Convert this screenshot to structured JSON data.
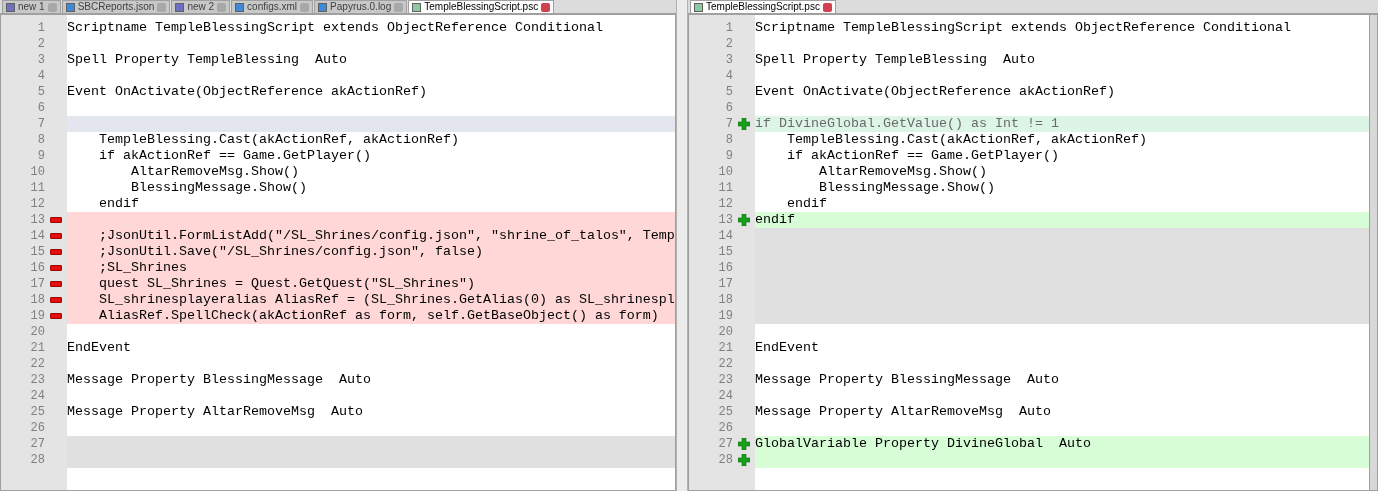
{
  "left_pane": {
    "tabs": [
      {
        "label": "new 1",
        "selected": false,
        "color": "#7070c0"
      },
      {
        "label": "SBCReports.json",
        "selected": false,
        "color": "#3c8ad8"
      },
      {
        "label": "new 2",
        "selected": false,
        "color": "#7070c0"
      },
      {
        "label": "configs.xml",
        "selected": false,
        "color": "#3c8ad8"
      },
      {
        "label": "Papyrus.0.log",
        "selected": false,
        "color": "#3c8ad8"
      },
      {
        "label": "TempleBlessingScript.psc",
        "selected": true,
        "color": "#8cc8a0"
      }
    ],
    "lines": [
      {
        "n": "1",
        "kind": "normal",
        "text": "Scriptname TempleBlessingScript extends ObjectReference Conditional"
      },
      {
        "n": "2",
        "kind": "normal"
      },
      {
        "n": "3",
        "kind": "normal",
        "text": "Spell Property TempleBlessing  Auto"
      },
      {
        "n": "4",
        "kind": "normal"
      },
      {
        "n": "5",
        "kind": "normal",
        "text": "Event OnActivate(ObjectReference akActionRef)"
      },
      {
        "n": "6",
        "kind": "normal"
      },
      {
        "n": "7",
        "kind": "changed-blank"
      },
      {
        "n": "8",
        "kind": "normal",
        "text": "    TempleBlessing.Cast(akActionRef, akActionRef)"
      },
      {
        "n": "9",
        "kind": "normal",
        "text": "    if akActionRef == Game.GetPlayer()"
      },
      {
        "n": "10",
        "kind": "normal",
        "text": "        AltarRemoveMsg.Show()"
      },
      {
        "n": "11",
        "kind": "normal",
        "text": "        BlessingMessage.Show()"
      },
      {
        "n": "12",
        "kind": "normal",
        "text": "    endif"
      },
      {
        "n": "13",
        "kind": "removed"
      },
      {
        "n": "14",
        "kind": "removed",
        "text": "    ;JsonUtil.FormListAdd(\"/SL_Shrines/config.json\", \"shrine_of_talos\", Temp"
      },
      {
        "n": "15",
        "kind": "removed",
        "text": "    ;JsonUtil.Save(\"/SL_Shrines/config.json\", false)"
      },
      {
        "n": "16",
        "kind": "removed",
        "text": "    ;SL_Shrines"
      },
      {
        "n": "17",
        "kind": "removed",
        "text": "    quest SL_Shrines = Quest.GetQuest(\"SL_Shrines\")"
      },
      {
        "n": "18",
        "kind": "removed",
        "text": "    SL_shrinesplayeralias AliasRef = (SL_Shrines.GetAlias(0) as SL_shrinespl"
      },
      {
        "n": "19",
        "kind": "removed",
        "text": "    AliasRef.SpellCheck(akActionRef as form, self.GetBaseObject() as form)"
      },
      {
        "n": "20",
        "kind": "normal"
      },
      {
        "n": "21",
        "kind": "normal",
        "text": "EndEvent"
      },
      {
        "n": "22",
        "kind": "normal"
      },
      {
        "n": "23",
        "kind": "normal",
        "text": "Message Property BlessingMessage  Auto"
      },
      {
        "n": "24",
        "kind": "normal"
      },
      {
        "n": "25",
        "kind": "normal",
        "text": "Message Property AltarRemoveMsg  Auto"
      },
      {
        "n": "26",
        "kind": "normal"
      },
      {
        "n": "27",
        "kind": "blank"
      },
      {
        "n": "28",
        "kind": "blank"
      }
    ]
  },
  "right_pane": {
    "tabs": [
      {
        "label": "TempleBlessingScript.psc",
        "selected": true,
        "color": "#8cc8a0"
      }
    ],
    "lines": [
      {
        "n": "1",
        "kind": "normal",
        "text": "Scriptname TempleBlessingScript extends ObjectReference Conditional"
      },
      {
        "n": "2",
        "kind": "normal"
      },
      {
        "n": "3",
        "kind": "normal",
        "text": "Spell Property TempleBlessing  Auto"
      },
      {
        "n": "4",
        "kind": "normal"
      },
      {
        "n": "5",
        "kind": "normal",
        "text": "Event OnActivate(ObjectReference akActionRef)"
      },
      {
        "n": "6",
        "kind": "normal"
      },
      {
        "n": "7",
        "kind": "changed",
        "text": "if DivineGlobal.GetValue() as Int != 1"
      },
      {
        "n": "8",
        "kind": "normal",
        "text": "    TempleBlessing.Cast(akActionRef, akActionRef)"
      },
      {
        "n": "9",
        "kind": "normal",
        "text": "    if akActionRef == Game.GetPlayer()"
      },
      {
        "n": "10",
        "kind": "normal",
        "text": "        AltarRemoveMsg.Show()"
      },
      {
        "n": "11",
        "kind": "normal",
        "text": "        BlessingMessage.Show()"
      },
      {
        "n": "12",
        "kind": "normal",
        "text": "    endif"
      },
      {
        "n": "13",
        "kind": "added",
        "text": "endif"
      },
      {
        "n": "14",
        "kind": "blank"
      },
      {
        "n": "15",
        "kind": "blank"
      },
      {
        "n": "16",
        "kind": "blank"
      },
      {
        "n": "17",
        "kind": "blank"
      },
      {
        "n": "18",
        "kind": "blank"
      },
      {
        "n": "19",
        "kind": "blank"
      },
      {
        "n": "20",
        "kind": "normal"
      },
      {
        "n": "21",
        "kind": "normal",
        "text": "EndEvent"
      },
      {
        "n": "22",
        "kind": "normal"
      },
      {
        "n": "23",
        "kind": "normal",
        "text": "Message Property BlessingMessage  Auto"
      },
      {
        "n": "24",
        "kind": "normal"
      },
      {
        "n": "25",
        "kind": "normal",
        "text": "Message Property AltarRemoveMsg  Auto"
      },
      {
        "n": "26",
        "kind": "normal"
      },
      {
        "n": "27",
        "kind": "added",
        "text": "GlobalVariable Property DivineGlobal  Auto"
      },
      {
        "n": "28",
        "kind": "added"
      }
    ]
  }
}
